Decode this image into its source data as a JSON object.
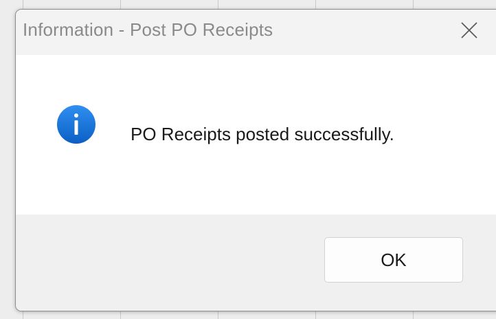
{
  "dialog": {
    "title": "Information - Post PO Receipts",
    "close_icon": "close-icon",
    "info_icon": "info-icon",
    "message": "PO Receipts posted successfully.",
    "ok_label": "OK"
  },
  "colors": {
    "info_icon_blue": "#1a73d9",
    "title_text": "#8a8a8a",
    "content_bg": "#ffffff",
    "footer_bg": "#f0f0f0"
  }
}
